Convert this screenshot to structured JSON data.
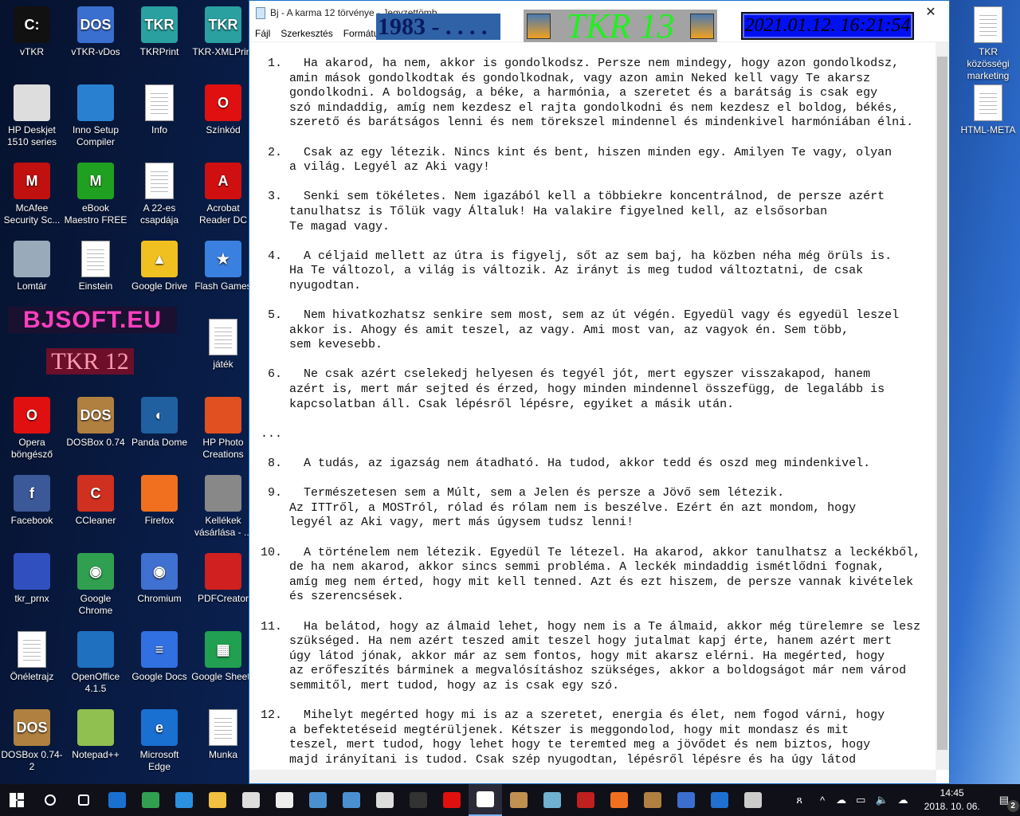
{
  "desktop": {
    "icons": [
      {
        "label": "vTKR",
        "color": "#111",
        "glyph": "C:"
      },
      {
        "label": "vTKR-vDos",
        "color": "#3a6fd0",
        "glyph": "DOS"
      },
      {
        "label": "TKRPrint",
        "color": "#2aa0a0",
        "glyph": "TKR"
      },
      {
        "label": "TKR-XMLPrint",
        "color": "#2aa0a0",
        "glyph": "TKR"
      },
      {
        "label": "HP Deskjet 1510 series",
        "color": "#ddd",
        "glyph": ""
      },
      {
        "label": "Inno Setup Compiler",
        "color": "#2a80d0",
        "glyph": ""
      },
      {
        "label": "Info",
        "doc": true
      },
      {
        "label": "Színkód",
        "color": "#e01010",
        "glyph": "O"
      },
      {
        "label": "McAfee Security Sc...",
        "color": "#c01010",
        "glyph": "M"
      },
      {
        "label": "eBook Maestro FREE",
        "color": "#20a020",
        "glyph": "M"
      },
      {
        "label": "A 22-es csapdája",
        "doc": true
      },
      {
        "label": "Acrobat Reader DC",
        "color": "#d01010",
        "glyph": "A"
      },
      {
        "label": "Lomtár",
        "color": "#9ab",
        "glyph": ""
      },
      {
        "label": "Einstein",
        "doc": true
      },
      {
        "label": "Google Drive",
        "color": "#f0c020",
        "glyph": "▲"
      },
      {
        "label": "Flash Games",
        "color": "#3a80e0",
        "glyph": "★"
      },
      {
        "label": "játék",
        "doc": true
      },
      {
        "label": "Opera böngésző",
        "color": "#e01010",
        "glyph": "O"
      },
      {
        "label": "DOSBox 0.74",
        "color": "#b08040",
        "glyph": "DOS"
      },
      {
        "label": "Panda Dome",
        "color": "#2060a0",
        "glyph": "◐"
      },
      {
        "label": "HP Photo Creations",
        "color": "#e05020",
        "glyph": ""
      },
      {
        "label": "Facebook",
        "color": "#3b5998",
        "glyph": "f"
      },
      {
        "label": "CCleaner",
        "color": "#d03020",
        "glyph": "C"
      },
      {
        "label": "Firefox",
        "color": "#f07020",
        "glyph": ""
      },
      {
        "label": "Kellékek vásárlása - ...",
        "color": "#888",
        "glyph": ""
      },
      {
        "label": "tkr_prnx",
        "color": "#3050c0",
        "glyph": ""
      },
      {
        "label": "Google Chrome",
        "color": "#30a050",
        "glyph": "◉"
      },
      {
        "label": "Chromium",
        "color": "#4070d0",
        "glyph": "◉"
      },
      {
        "label": "PDFCreator",
        "color": "#d02020",
        "glyph": ""
      },
      {
        "label": "Önéletrajz",
        "doc": true
      },
      {
        "label": "OpenOffice 4.1.5",
        "color": "#2070c0",
        "glyph": ""
      },
      {
        "label": "Google Docs",
        "color": "#3070e0",
        "glyph": "≡"
      },
      {
        "label": "Google Sheets",
        "color": "#20a050",
        "glyph": "▦"
      },
      {
        "label": "DOSBox 0.74-2",
        "color": "#b08040",
        "glyph": "DOS"
      },
      {
        "label": "Notepad++",
        "color": "#90c050",
        "glyph": ""
      },
      {
        "label": "Microsoft Edge",
        "color": "#1a70d0",
        "glyph": "e"
      },
      {
        "label": "Munka",
        "doc": true
      },
      {
        "label": "TKR közösségi marketing",
        "doc": true
      },
      {
        "label": "HTML-META",
        "doc": true
      }
    ],
    "banner_bjsoft": "BJSOFT.EU",
    "banner_tkr12": "TKR 12"
  },
  "window": {
    "title": "Bj - A karma 12 törvénye - Jegyzettömb",
    "minimize": "—",
    "close": "✕",
    "menu": [
      "Fájl",
      "Szerkesztés",
      "Formátum"
    ],
    "banner_year": "1983 - . . . .",
    "banner_tkr13": "TKR 13",
    "banner_date": "2021.01.12. 16:21:54",
    "text": " 1.   Ha akarod, ha nem, akkor is gondolkodsz. Persze nem mindegy, hogy azon gondolkodsz,\n    amin mások gondolkodtak és gondolkodnak, vagy azon amin Neked kell vagy Te akarsz\n    gondolkodni. A boldogság, a béke, a harmónia, a szeretet és a barátság is csak egy\n    szó mindaddig, amíg nem kezdesz el rajta gondolkodni és nem kezdesz el boldog, békés,\n    szerető és barátságos lenni és nem törekszel mindennel és mindenkivel harmóniában élni.\n\n 2.   Csak az egy létezik. Nincs kint és bent, hiszen minden egy. Amilyen Te vagy, olyan\n    a világ. Legyél az Aki vagy!\n\n 3.   Senki sem tökéletes. Nem igazából kell a többiekre koncentrálnod, de persze azért\n    tanulhatsz is Tőlük vagy Általuk! Ha valakire figyelned kell, az elsősorban\n    Te magad vagy.\n\n 4.   A céljaid mellett az útra is figyelj, sőt az sem baj, ha közben néha még örüls is.\n    Ha Te változol, a világ is változik. Az irányt is meg tudod változtatni, de csak\n    nyugodtan.\n\n 5.   Nem hivatkozhatsz senkire sem most, sem az út végén. Egyedül vagy és egyedül leszel\n    akkor is. Ahogy és amit teszel, az vagy. Ami most van, az vagyok én. Sem több,\n    sem kevesebb.\n\n 6.   Ne csak azért cselekedj helyesen és tegyél jót, mert egyszer visszakapod, hanem\n    azért is, mert már sejted és érzed, hogy minden mindennel összefügg, de legalább is\n    kapcsolatban áll. Csak lépésről lépésre, egyiket a másik után.\n\n...\n\n 8.   A tudás, az igazság nem átadható. Ha tudod, akkor tedd és oszd meg mindenkivel.\n\n 9.   Természetesen sem a Múlt, sem a Jelen és persze a Jövő sem létezik.\n    Az ITTről, a MOSTról, rólad és rólam nem is beszélve. Ezért én azt mondom, hogy\n    legyél az Aki vagy, mert más úgysem tudsz lenni!\n\n10.   A történelem nem létezik. Egyedül Te létezel. Ha akarod, akkor tanulhatsz a leckékből,\n    de ha nem akarod, akkor sincs semmi probléma. A leckék mindaddig ismétlődni fognak,\n    amíg meg nem érted, hogy mit kell tenned. Azt és ezt hiszem, de persze vannak kivételek\n    és szerencsések.\n\n11.   Ha belátod, hogy az álmaid lehet, hogy nem is a Te álmaid, akkor még türelemre se lesz\n    szükséged. Ha nem azért teszed amit teszel hogy jutalmat kapj érte, hanem azért mert\n    úgy látod jónak, akkor már az sem fontos, hogy mit akarsz elérni. Ha megérted, hogy\n    az erőfeszítés bárminek a megvalósításhoz szükséges, akkor a boldogságot már nem várod\n    semmitől, mert tudod, hogy az is csak egy szó.\n\n12.   Mihelyt megérted hogy mi is az a szeretet, energia és élet, nem fogod várni, hogy\n    a befektetéseid megtérüljenek. Kétszer is meggondolod, hogy mit mondasz és mit\n    teszel, mert tudod, hogy lehet hogy te teremted meg a jövődet és nem biztos, hogy\n    majd irányítani is tudod. Csak szép nyugodtan, lépésről lépésre és ha úgy látod\n    jónak, akkor egy kicsit állj is meg és pihenj."
  },
  "taskbar": {
    "time": "14:45",
    "date": "2018. 10. 06.",
    "notifications": "2",
    "apps": [
      {
        "name": "start",
        "c": "#fff"
      },
      {
        "name": "search",
        "c": "#fff"
      },
      {
        "name": "task-view",
        "c": "#fff"
      },
      {
        "name": "edge",
        "c": "#1a70d0"
      },
      {
        "name": "chrome",
        "c": "#30a050"
      },
      {
        "name": "ie",
        "c": "#2a90e0"
      },
      {
        "name": "explorer",
        "c": "#f0c040"
      },
      {
        "name": "store",
        "c": "#ddd"
      },
      {
        "name": "mail",
        "c": "#eee"
      },
      {
        "name": "app",
        "c": "#4a90d0"
      },
      {
        "name": "app2",
        "c": "#4a90d0"
      },
      {
        "name": "settings",
        "c": "#ddd"
      },
      {
        "name": "cmd",
        "c": "#333"
      },
      {
        "name": "opera",
        "c": "#e01010"
      },
      {
        "name": "notepad",
        "c": "#fff"
      },
      {
        "name": "paint",
        "c": "#c09050"
      },
      {
        "name": "app3",
        "c": "#70b0d0"
      },
      {
        "name": "filezilla",
        "c": "#c02020"
      },
      {
        "name": "firefox",
        "c": "#f07020"
      },
      {
        "name": "dosbox",
        "c": "#b08040"
      },
      {
        "name": "vdos",
        "c": "#3a6fd0"
      },
      {
        "name": "app4",
        "c": "#2070d0"
      },
      {
        "name": "calculator",
        "c": "#ccc"
      }
    ]
  }
}
